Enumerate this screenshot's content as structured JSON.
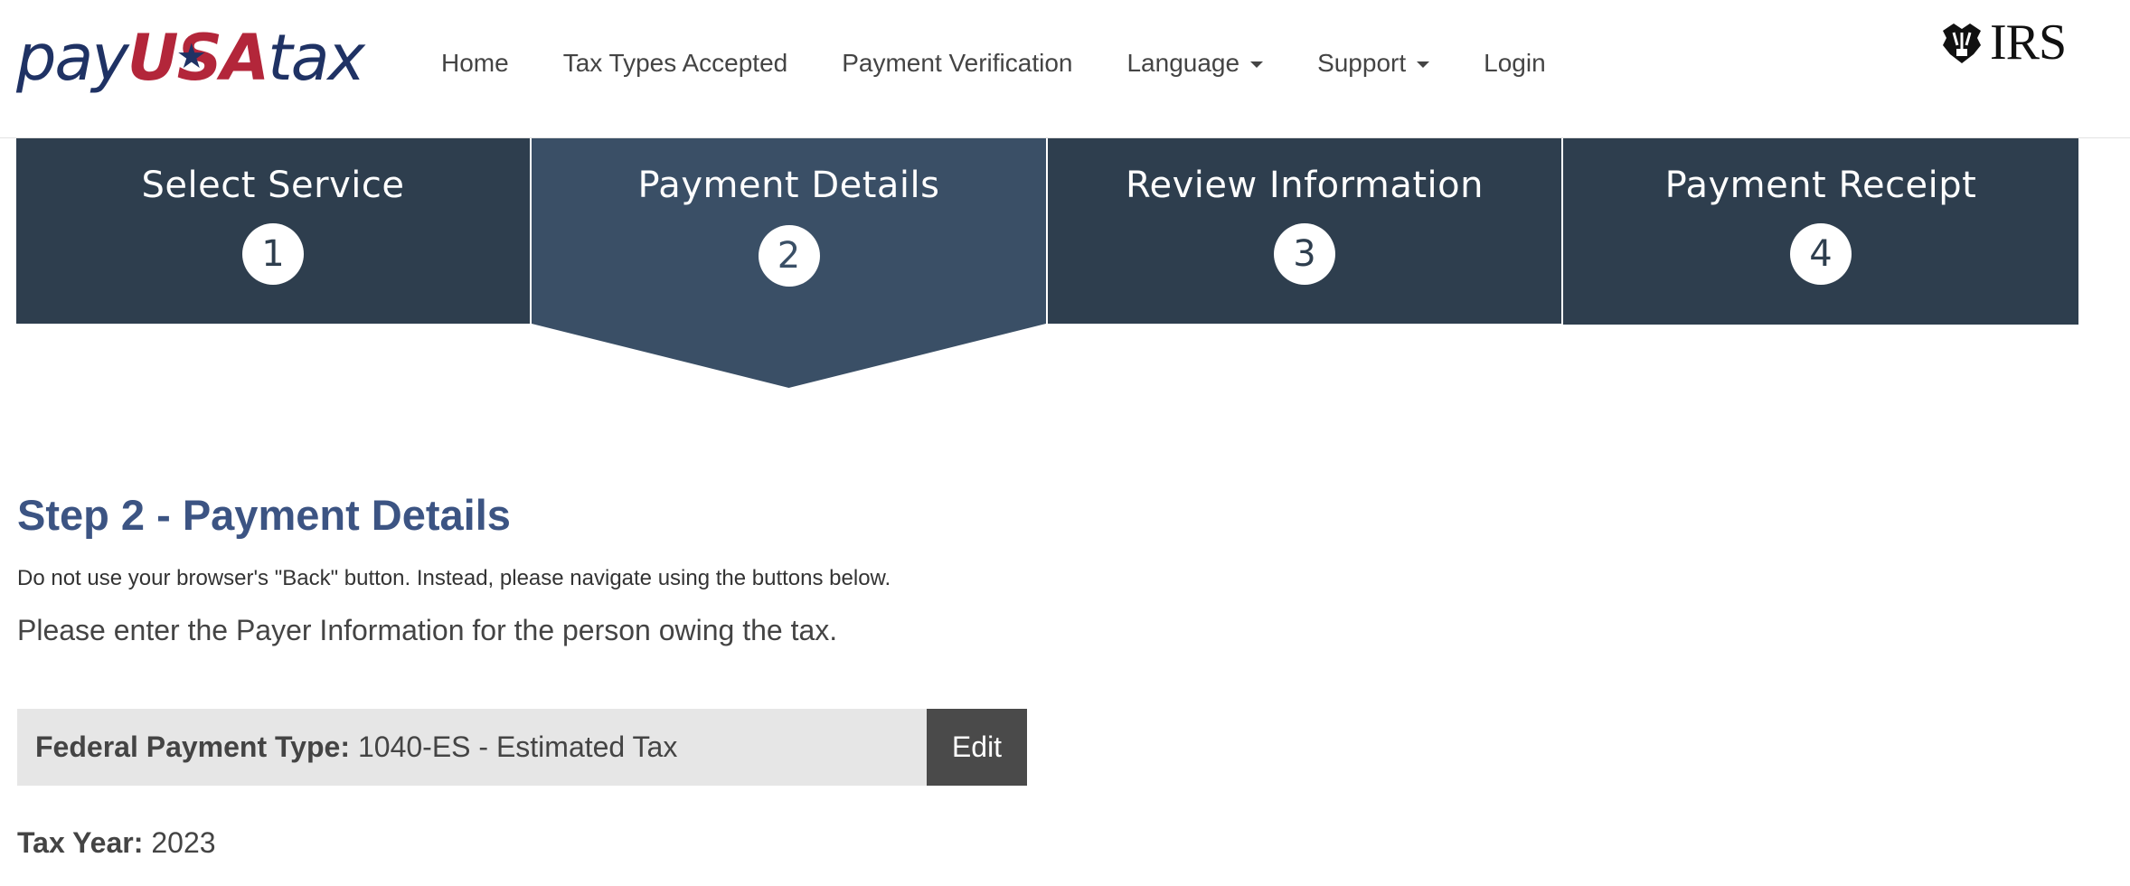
{
  "header": {
    "logo": {
      "pay": "pay",
      "usa": "USA",
      "tax": "tax"
    },
    "nav": [
      {
        "label": "Home"
      },
      {
        "label": "Tax Types Accepted"
      },
      {
        "label": "Payment Verification"
      },
      {
        "label": "Language",
        "dropdown": true
      },
      {
        "label": "Support",
        "dropdown": true
      },
      {
        "label": "Login"
      }
    ],
    "irs_logo_text": "IRS"
  },
  "steps": [
    {
      "title": "Select Service",
      "number": "1",
      "active": false
    },
    {
      "title": "Payment Details",
      "number": "2",
      "active": true
    },
    {
      "title": "Review Information",
      "number": "3",
      "active": false
    },
    {
      "title": "Payment Receipt",
      "number": "4",
      "active": false
    }
  ],
  "main": {
    "title": "Step 2 - Payment Details",
    "note": "Do not use your browser's \"Back\" button. Instead, please navigate using the buttons below.",
    "prompt": "Please enter the Payer Information for the person owing the tax.",
    "payment_type_label": "Federal Payment Type:",
    "payment_type_value": "1040-ES - Estimated Tax",
    "edit_label": "Edit",
    "tax_year_label": "Tax Year:",
    "tax_year_value": "2023"
  },
  "colors": {
    "step_bg": "#2e3e4e",
    "step_active_bg": "#3a4f66",
    "title_blue": "#3c5483",
    "brand_navy": "#1f3264",
    "brand_red": "#b3263a",
    "edit_button": "#4a4a4a"
  },
  "icons": {
    "irs_logo": "irs-eagle-icon",
    "dropdown": "caret-down-icon"
  }
}
